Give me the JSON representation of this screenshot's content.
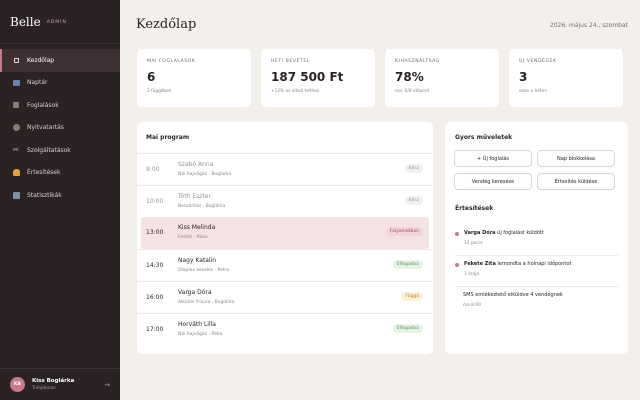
{
  "brand": {
    "name": "Belle",
    "tag": "ADMIN"
  },
  "sidebar": {
    "items": [
      {
        "label": "Kezdőlap",
        "icon": "home-icon",
        "active": true
      },
      {
        "label": "Naptár",
        "icon": "calendar-icon"
      },
      {
        "label": "Foglalások",
        "icon": "list-icon"
      },
      {
        "label": "Nyitvatartás",
        "icon": "clock-icon"
      },
      {
        "label": "Szolgáltatások",
        "icon": "scissors-icon"
      },
      {
        "label": "Értesítések",
        "icon": "bell-icon"
      },
      {
        "label": "Statisztikák",
        "icon": "chart-icon"
      }
    ],
    "user": {
      "initials": "KB",
      "name": "Kiss Boglárka",
      "role": "Tulajdonos"
    }
  },
  "header": {
    "title": "Kezdőlap",
    "date": "2026. május 24., szombat"
  },
  "stats": [
    {
      "label": "MAI FOGLALÁSOK",
      "value": "6",
      "sub": "2 függőben"
    },
    {
      "label": "HETI BEVÉTEL",
      "value": "187 500 Ft",
      "sub": "+12% az előző héthez"
    },
    {
      "label": "KIHASZNÁLTSÁG",
      "value": "78%",
      "sub": "ma: 6/8 időpont"
    },
    {
      "label": "ÚJ VENDÉGEK",
      "value": "3",
      "sub": "ezen a héten"
    }
  ],
  "program": {
    "title": "Mai program",
    "rows": [
      {
        "time": "9:00",
        "name": "Szabó Anna",
        "detail": "Női hajvágás · Boglárka",
        "status": "Kész",
        "state": "done"
      },
      {
        "time": "10:00",
        "name": "Tóth Eszter",
        "detail": "Beszárítás · Boglárka",
        "status": "Kész",
        "state": "done"
      },
      {
        "time": "13:00",
        "name": "Kiss Melinda",
        "detail": "Festés · Réka",
        "status": "Folyamatban",
        "state": "current"
      },
      {
        "time": "14:30",
        "name": "Nagy Katalin",
        "detail": "Ólaplex kezelés · Petra",
        "status": "Elfogadva",
        "state": "ok"
      },
      {
        "time": "16:00",
        "name": "Varga Dóra",
        "detail": "Alkalmi frizura · Boglárka",
        "status": "Függő",
        "state": "pending"
      },
      {
        "time": "17:00",
        "name": "Horváth Lilla",
        "detail": "Női hajvágás · Réka",
        "status": "Elfogadva",
        "state": "ok"
      }
    ]
  },
  "quick": {
    "title": "Gyors műveletek",
    "buttons": [
      "+ Új foglalás",
      "Nap blokkolása",
      "Vendég keresése",
      "Értesítés küldése"
    ]
  },
  "notifications": {
    "title": "Értesítések",
    "items": [
      {
        "who": "Varga Dóra",
        "text": " új foglalást küldött",
        "time": "12 perce"
      },
      {
        "who": "Fekete Zita",
        "text": " lemondta a holnapi időpontot",
        "time": "1 órája"
      },
      {
        "who": "",
        "text": "SMS emlékeztető elküldve 4 vendégnek",
        "time": "ma 8:00"
      }
    ]
  }
}
